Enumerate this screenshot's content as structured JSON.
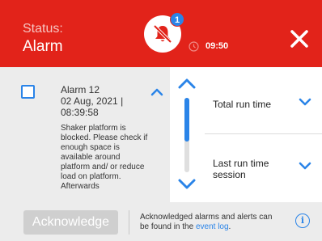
{
  "header": {
    "status_label": "Status:",
    "status_value": "Alarm",
    "badge_count": "1",
    "time": "09:50",
    "colors": {
      "background": "#e2231a",
      "badge": "#2a84e8"
    },
    "icons": {
      "main": "muted-bell-icon",
      "time": "clock-icon",
      "close": "close-icon"
    }
  },
  "alarm": {
    "title": "Alarm 12",
    "date": "02 Aug, 2021 | 08:39:58",
    "description": "Shaker platform is blocked. Please check if enough space is available around platform and/ or reduce load on platform. Afterwards",
    "icons": {
      "checkbox": "checkbox-icon",
      "collapse": "chevron-up-icon"
    }
  },
  "scroll": {
    "up_icon": "chevron-up-icon",
    "down_icon": "chevron-down-icon",
    "thumb_fraction": 0.59,
    "accent": "#2a84e8"
  },
  "details": {
    "rows": [
      {
        "label": "Total run time",
        "icon": "chevron-down-icon"
      },
      {
        "label": "Last run time session",
        "icon": "chevron-down-icon"
      }
    ]
  },
  "footer": {
    "acknowledge_label": "Acknowledge",
    "note_text": "Acknowledged alarms and alerts can be found in the ",
    "note_link": "event log",
    "note_end": ".",
    "info_icon": "info-icon",
    "info_glyph": "i"
  }
}
